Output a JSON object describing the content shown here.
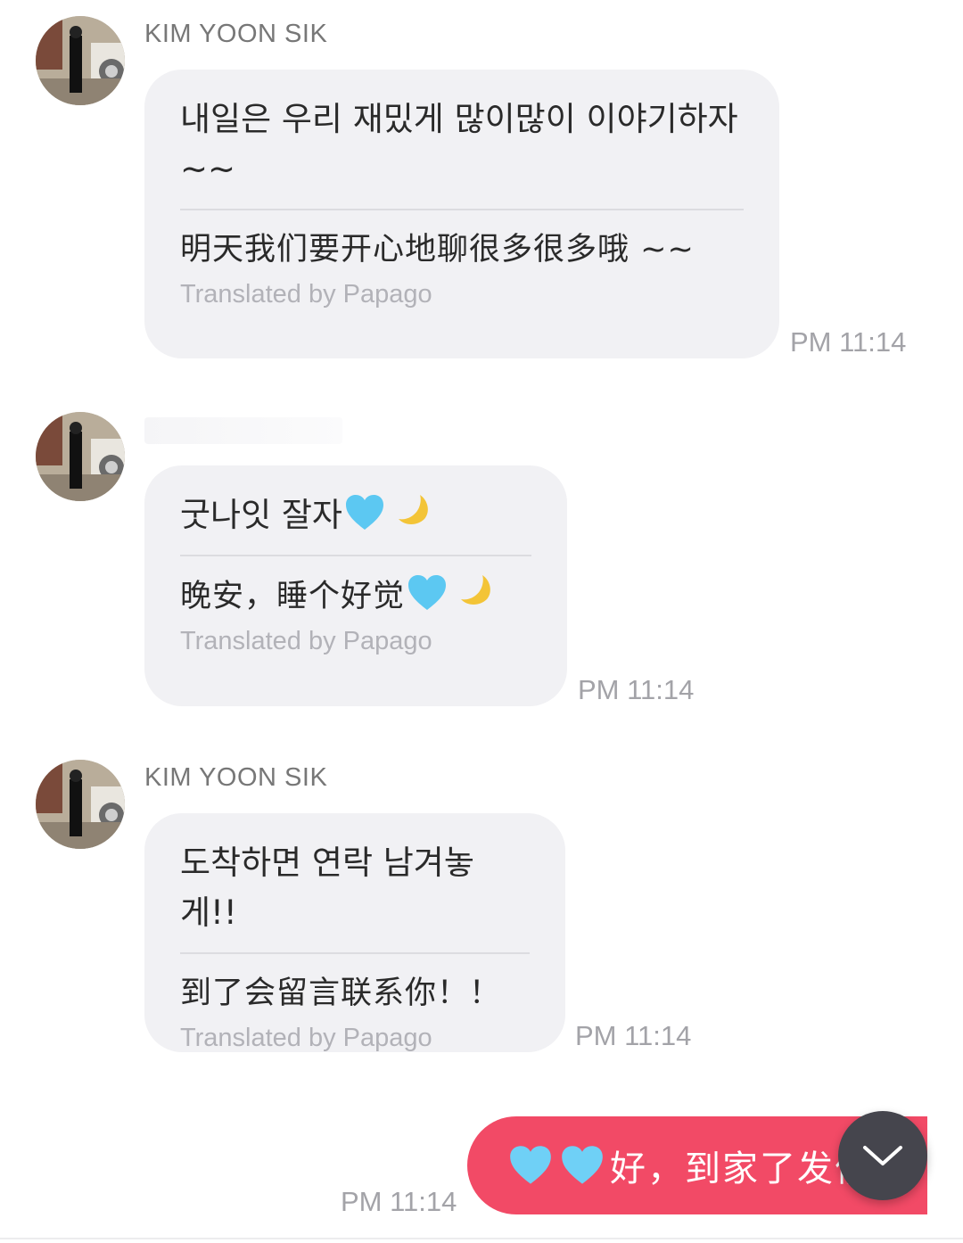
{
  "messages": [
    {
      "sender": "KIM YOON SIK",
      "original": "내일은 우리 재밌게 많이많이 이야기하자 ~~",
      "translation": "明天我们要开心地聊很多很多哦 ~~",
      "translator": "Translated by Papago",
      "time": "PM 11:14"
    },
    {
      "sender": "",
      "original": "굿나잇 잘자",
      "translation": "晚安，睡个好觉",
      "translator": "Translated by Papago",
      "time": "PM 11:14"
    },
    {
      "sender": "KIM YOON SIK",
      "original": "도착하면 연락 남겨놓게!!",
      "translation": "到了会留言联系你！！",
      "translator": "Translated by Papago",
      "time": "PM 11:14"
    }
  ],
  "outgoing": {
    "text": "好，到家了发信",
    "time": "PM 11:14",
    "emoji": [
      "blue-heart",
      "blue-heart"
    ]
  },
  "colors": {
    "bubble_in": "#f1f1f4",
    "bubble_out": "#f24a66",
    "time_text": "#a3a3a8",
    "scroll_button": "#45454d"
  },
  "icons": [
    "blue-heart-icon",
    "crescent-moon-icon",
    "chevron-down-icon"
  ]
}
